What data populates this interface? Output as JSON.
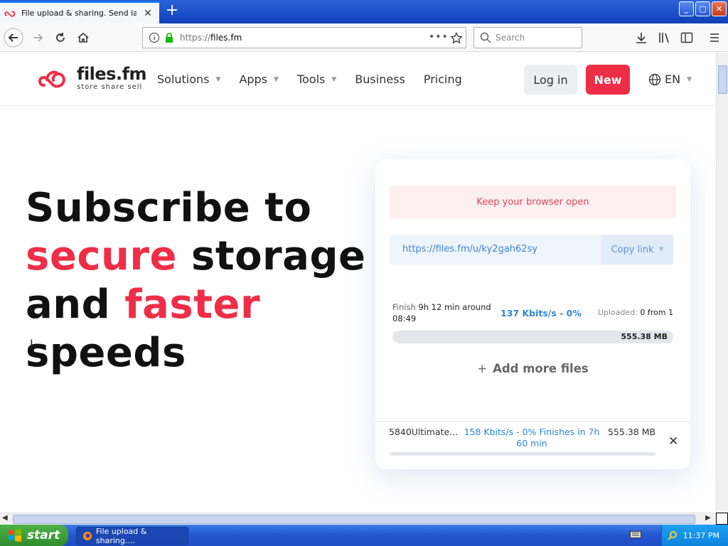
{
  "browser": {
    "tab_title": "File upload & sharing. Send large p",
    "url_scheme": "https://",
    "url_host": "files.fm",
    "search_placeholder": "Search"
  },
  "site": {
    "logo_name": "files.fm",
    "logo_tagline": "store  share  sell",
    "menu": [
      {
        "label": "Solutions",
        "has_caret": true
      },
      {
        "label": "Apps",
        "has_caret": true
      },
      {
        "label": "Tools",
        "has_caret": true
      },
      {
        "label": "Business",
        "has_caret": false
      },
      {
        "label": "Pricing",
        "has_caret": false
      }
    ],
    "login_label": "Log in",
    "new_label": "New",
    "lang_label": "EN",
    "colors": {
      "accent": "#ee2e47",
      "link": "#2f86d3"
    }
  },
  "hero": {
    "line1": "Subscribe to",
    "line2_red": "secure",
    "line2_rest": " storage",
    "line3_start": "and ",
    "line3_red": "faster",
    "line4": "speeds"
  },
  "upload": {
    "notice": "Keep your browser open",
    "share_url": "https://files.fm/u/ky2gah62sy",
    "copy_label": "Copy link",
    "finish_label": "Finish",
    "finish_value": "9h 12 min around 08:49",
    "speed": "137 Kbits/s - 0%",
    "uploaded_label": "Uploaded:",
    "uploaded_value": "0 from 1",
    "progress_fraction": 0.0,
    "total_size": "555.38 MB",
    "add_more": "Add more files",
    "file": {
      "name": "5840Ultimate...",
      "speed_status": "158 Kbits/s - 0%   Finishes in 7h 60 min",
      "size": "555.38 MB",
      "progress_fraction": 0.0
    }
  },
  "taskbar": {
    "start_label": "start",
    "task_label": "File upload & sharing....",
    "clock": "11:37 PM"
  }
}
